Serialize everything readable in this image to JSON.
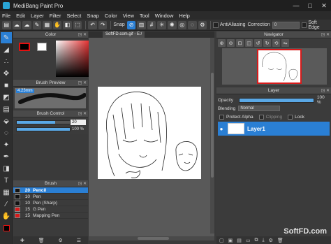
{
  "window": {
    "title": "MediBang Paint Pro",
    "min": "—",
    "max": "□",
    "close": "✕"
  },
  "menu": [
    "File",
    "Edit",
    "Layer",
    "Filter",
    "Select",
    "Snap",
    "Color",
    "View",
    "Tool",
    "Window",
    "Help"
  ],
  "toolbar": {
    "snap_label": "Snap",
    "antialiasing_label": "AntiAliasing",
    "correction_label": "Correction",
    "correction_value": "0",
    "soft_edge_label": "Soft Edge"
  },
  "panels": {
    "color": "Color",
    "brush_preview": "Brush Preview",
    "brush_control": "Brush Control",
    "brush": "Brush",
    "navigator": "Navigator",
    "layer": "Layer"
  },
  "brush_preview": {
    "size_tag": "4.23mm"
  },
  "brush_control": {
    "size_value": "20",
    "size_fraction": 0.72,
    "opacity_value": "100 %",
    "opacity_fraction": 1.0
  },
  "brushes": [
    {
      "size": "20",
      "name": "Pencil",
      "color": "#111111",
      "selected": true
    },
    {
      "size": "10",
      "name": "Pen",
      "color": "#111111",
      "selected": false
    },
    {
      "size": "10",
      "name": "Pen (Sharp)",
      "color": "#111111",
      "selected": false
    },
    {
      "size": "15",
      "name": "G Pen",
      "color": "#d71b1b",
      "selected": false
    },
    {
      "size": "15",
      "name": "Mapping Pen",
      "color": "#d71b1b",
      "selected": false
    }
  ],
  "document": {
    "tab": "SoftFD.com.gif - E:/"
  },
  "layer_panel": {
    "opacity_label": "Opacity",
    "opacity_value": "100 %",
    "blending_label": "Blending",
    "blending_value": "Normal",
    "protect_alpha_label": "Protect Alpha",
    "clipping_label": "Clipping",
    "lock_label": "Lock",
    "layer_name": "Layer1"
  },
  "watermark": "SoftFD.com",
  "colors": {
    "accent": "#2a7fd4",
    "selected_fg": "#000000",
    "fg_border": "#e31010",
    "bg": "#ffffff"
  }
}
